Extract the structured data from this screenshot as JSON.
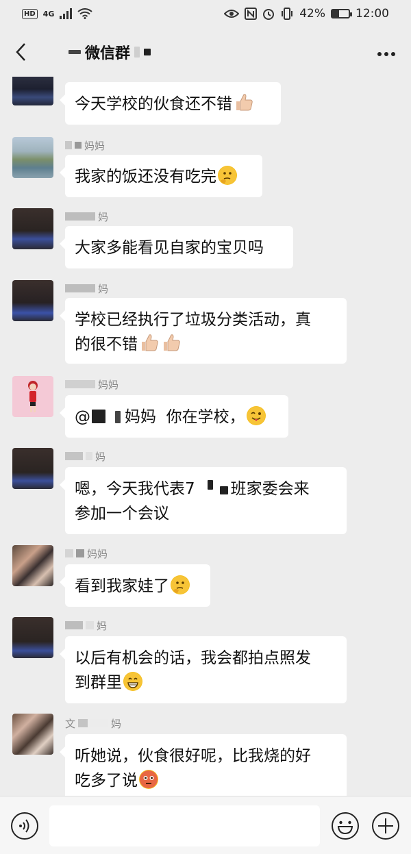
{
  "status_bar": {
    "hd": "HD",
    "network": "4G",
    "battery_text": "42%",
    "battery_level": 0.42,
    "time": "12:00",
    "icons": [
      "signal-icon",
      "wifi-icon",
      "eye-icon",
      "nfc-icon",
      "alarm-icon",
      "vibrate-icon",
      "battery-icon"
    ]
  },
  "nav": {
    "title": "微信群",
    "back_icon": "chevron-left-icon",
    "more_icon": "more-icon"
  },
  "messages": [
    {
      "sender": "",
      "text": "今天学校的伙食还不错",
      "emoji": [
        "thumbs-up"
      ]
    },
    {
      "sender": "妈妈",
      "text": "我家的饭还没有吃完",
      "emoji": [
        "thinking-face"
      ]
    },
    {
      "sender": "妈",
      "text": "大家多能看见自家的宝贝吗",
      "emoji": []
    },
    {
      "sender": "妈",
      "text_line1": "学校已经执行了垃圾分类活动，真",
      "text_line2": "的很不错",
      "emoji": [
        "thumbs-up",
        "thumbs-up"
      ]
    },
    {
      "sender": "妈妈",
      "text_prefix": "@",
      "text_mid": "妈妈",
      "text_suffix": "你在学校，",
      "emoji": [
        "winking-tongue-face"
      ]
    },
    {
      "sender": "妈",
      "text_line1_prefix": "嗯，今天我代表7",
      "text_line1_suffix": "班家委会来",
      "text_line2": "参加一个会议",
      "emoji": []
    },
    {
      "sender": "妈妈",
      "text": "看到我家娃了",
      "emoji": [
        "thinking-face"
      ]
    },
    {
      "sender": "妈",
      "text_line1": "以后有机会的话，我会都拍点照发",
      "text_line2": "到群里",
      "emoji": [
        "grinning-face"
      ]
    },
    {
      "sender_prefix": "文",
      "sender": "妈",
      "text_line1": "听她说，伙食很好呢，比我烧的好",
      "text_line2": "吃多了说",
      "emoji": [
        "flushed-face"
      ]
    }
  ],
  "input_bar": {
    "voice_icon": "voice-icon",
    "emoji_icon": "emoji-icon",
    "plus_icon": "plus-icon",
    "placeholder": ""
  }
}
